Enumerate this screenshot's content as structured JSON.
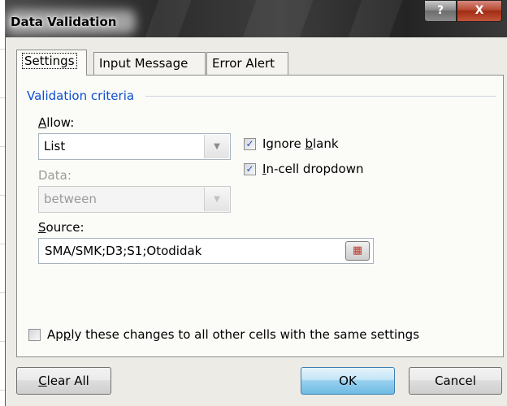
{
  "window": {
    "title": "Data Validation",
    "help_label": "?",
    "close_label": "X"
  },
  "tabs": [
    {
      "label": "Settings",
      "active": true
    },
    {
      "label": "Input Message",
      "active": false
    },
    {
      "label": "Error Alert",
      "active": false
    }
  ],
  "settings": {
    "group_label": "Validation criteria",
    "allow": {
      "prefix": "",
      "mnemonic": "A",
      "suffix": "llow:",
      "value": "List"
    },
    "data": {
      "label": "Data:",
      "value": "between",
      "enabled": false
    },
    "ignore_blank": {
      "prefix": "Ignore ",
      "mnemonic": "b",
      "suffix": "lank",
      "checked": true
    },
    "in_cell_dropdown": {
      "prefix": "",
      "mnemonic": "I",
      "suffix": "n-cell dropdown",
      "checked": true
    },
    "source": {
      "prefix": "",
      "mnemonic": "S",
      "suffix": "ource:",
      "value": "SMA/SMK;D3;S1;Otodidak"
    },
    "apply_all": {
      "prefix": "Ap",
      "mnemonic": "p",
      "suffix": "ly these changes to all other cells with the same settings",
      "checked": false
    }
  },
  "buttons": {
    "clear_all": {
      "prefix": "",
      "mnemonic": "C",
      "suffix": "lear All"
    },
    "ok": "OK",
    "cancel": "Cancel"
  },
  "colors": {
    "group_label": "#0e4fd1",
    "dialog_bg": "#ecebe6",
    "ok_button": "#98d1ef"
  }
}
